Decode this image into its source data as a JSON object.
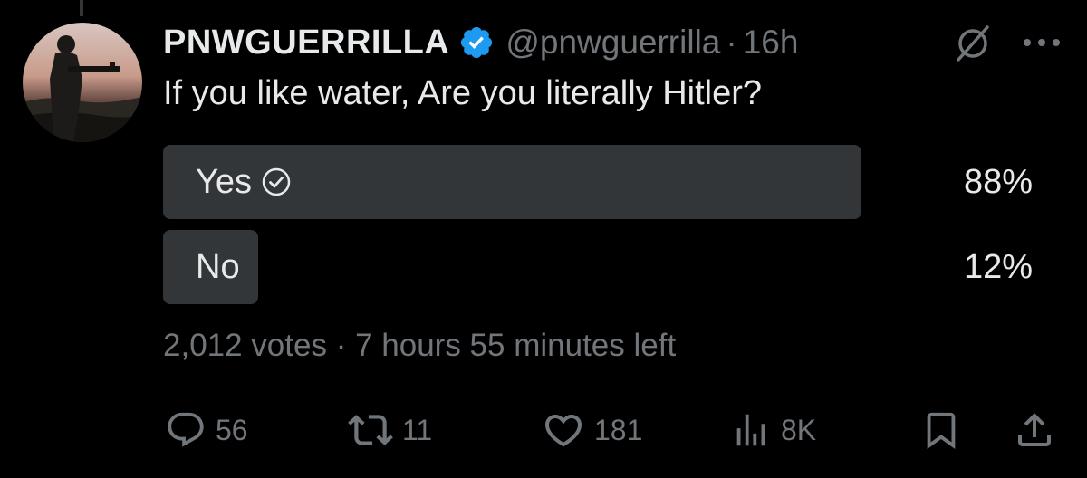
{
  "tweet": {
    "display_name": "PNWGUERRILLA",
    "handle": "@pnwguerrilla",
    "separator": "·",
    "time": "16h",
    "text": "If you like water, Are you literally Hitler?",
    "verified": true,
    "icons": {
      "verified": "verified-badge-icon",
      "grok": "grok-icon",
      "more": "more-options-icon"
    }
  },
  "poll": {
    "options": [
      {
        "label": "Yes",
        "percent_text": "88%",
        "percent": 88,
        "selected": true
      },
      {
        "label": "No",
        "percent_text": "12%",
        "percent": 12,
        "selected": false
      }
    ],
    "votes": "2,012 votes",
    "separator": "·",
    "time_left": "7 hours 55 minutes left"
  },
  "actions": {
    "replies": {
      "icon": "reply-icon",
      "count": "56"
    },
    "reposts": {
      "icon": "repost-icon",
      "count": "11"
    },
    "likes": {
      "icon": "like-icon",
      "count": "181"
    },
    "views": {
      "icon": "views-icon",
      "count": "8K"
    },
    "bookmark": {
      "icon": "bookmark-icon"
    },
    "share": {
      "icon": "share-icon"
    }
  },
  "colors": {
    "background": "#000000",
    "text_primary": "#e7e9ea",
    "text_secondary": "#71767b",
    "poll_bar": "#333639",
    "verified_blue": "#1d9bf0"
  }
}
